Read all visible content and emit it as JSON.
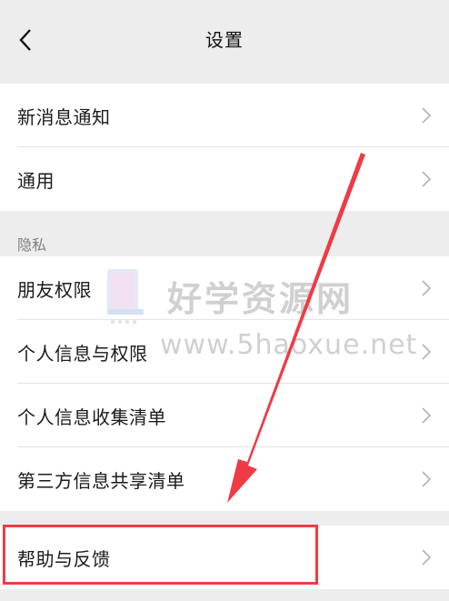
{
  "header": {
    "title": "设置"
  },
  "group1": [
    {
      "label": "新消息通知"
    },
    {
      "label": "通用"
    }
  ],
  "privacy": {
    "section_label": "隐私",
    "items": [
      {
        "label": "朋友权限"
      },
      {
        "label": "个人信息与权限"
      },
      {
        "label": "个人信息收集清单"
      },
      {
        "label": "第三方信息共享清单"
      }
    ]
  },
  "group3": [
    {
      "label": "帮助与反馈"
    }
  ],
  "watermark": {
    "title": "好学资源网",
    "url": "www.5haoxue.net"
  },
  "colors": {
    "annotation": "#ef3b45",
    "background": "#ededed",
    "surface": "#ffffff"
  }
}
